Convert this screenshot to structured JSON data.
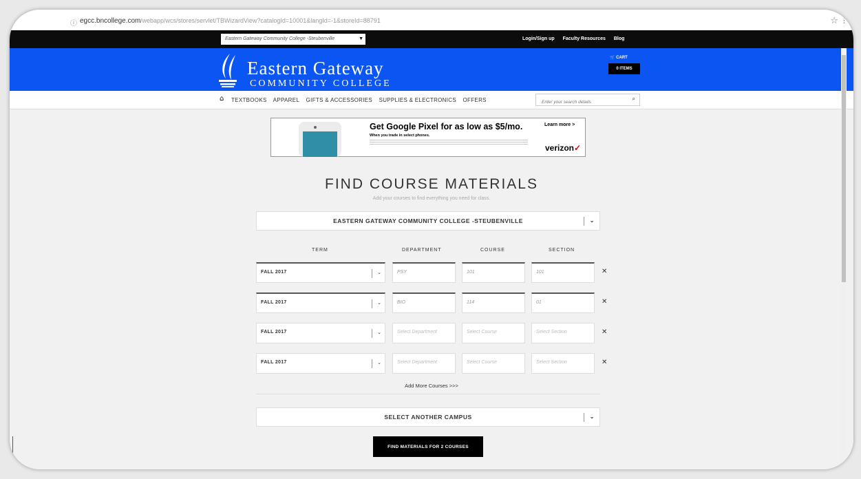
{
  "browser": {
    "url_host": "egcc.bncollege.com",
    "url_path": "/webapp/wcs/stores/servlet/TBWizardView?catalogId=10001&langId=-1&storeId=88791"
  },
  "topbar": {
    "store_select": "Eastern Gateway Community College -Steubenville",
    "links": [
      "Login/Sign up",
      "Faculty Resources",
      "Blog"
    ]
  },
  "header": {
    "logo_line1": "Eastern Gateway",
    "logo_line2": "COMMUNITY COLLEGE",
    "cart_label": "CART",
    "cart_items": "0 ITEMS",
    "brand_color": "#0b55f2"
  },
  "nav": {
    "items": [
      "TEXTBOOKS",
      "APPAREL",
      "GIFTS & ACCESSORIES",
      "SUPPLIES & ELECTRONICS",
      "OFFERS"
    ],
    "search_placeholder": "Enter your search details"
  },
  "ad": {
    "headline": "Get Google Pixel for as low as $5/mo.",
    "subline": "When you trade in select phones.",
    "cta": "Learn more >",
    "brand": "verizon"
  },
  "main": {
    "title": "FIND COURSE MATERIALS",
    "subtitle": "Add your courses to find everything you need for class.",
    "campus": "EASTERN GATEWAY COMMUNITY COLLEGE -STEUBENVILLE",
    "columns": [
      "TERM",
      "DEPARTMENT",
      "COURSE",
      "SECTION"
    ],
    "rows": [
      {
        "term": "FALL 2017",
        "department": "PSY",
        "course": "101",
        "section": "101"
      },
      {
        "term": "FALL 2017",
        "department": "BIO",
        "course": "114",
        "section": "01"
      },
      {
        "term": "FALL 2017",
        "department": "",
        "course": "",
        "section": ""
      },
      {
        "term": "FALL 2017",
        "department": "",
        "course": "",
        "section": ""
      }
    ],
    "placeholders": {
      "department": "Select Department",
      "course": "Select Course",
      "section": "Select Section"
    },
    "add_more": "Add More Courses >>>",
    "another_campus": "SELECT ANOTHER CAMPUS",
    "find_button": "FIND MATERIALS FOR 2 COURSES"
  }
}
